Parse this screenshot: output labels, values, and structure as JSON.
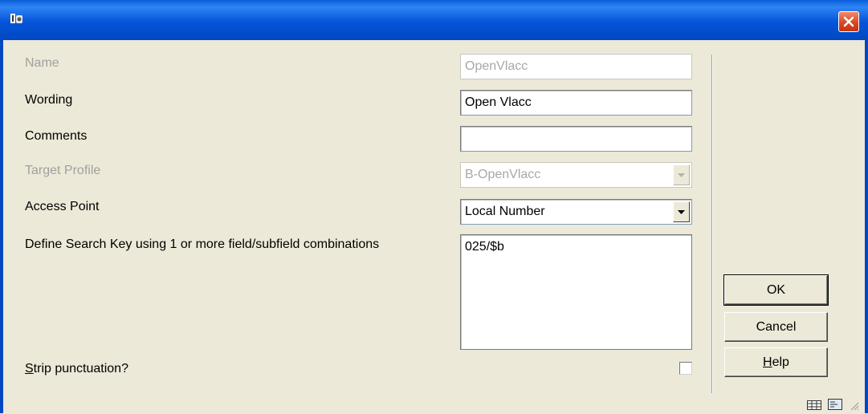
{
  "window": {
    "title": ""
  },
  "form": {
    "name": {
      "label": "Name",
      "value": "OpenVlacc"
    },
    "wording": {
      "label": "Wording",
      "value": "Open Vlacc"
    },
    "comments": {
      "label": "Comments",
      "value": ""
    },
    "target_profile": {
      "label": "Target Profile",
      "value": "B-OpenVlacc"
    },
    "access_point": {
      "label": "Access Point",
      "value": "Local Number"
    },
    "search_key": {
      "label": "Define Search Key using 1 or more field/subfield combinations",
      "value": "025/$b"
    },
    "strip_punctuation": {
      "label_mnemonic": "S",
      "label_rest": "trip punctuation?",
      "checked": false
    }
  },
  "buttons": {
    "ok": "OK",
    "cancel": "Cancel",
    "help_mnemonic": "H",
    "help_rest": "elp"
  },
  "icons": [
    "app-icon",
    "close-icon",
    "chevron-down-icon",
    "grid-view-icon",
    "form-view-icon",
    "resize-grip-icon"
  ],
  "colors": {
    "titlebar": "#0555d8",
    "close": "#d9431d",
    "dialog": "#ece9d8",
    "disabled_text": "#a0a0a0"
  }
}
